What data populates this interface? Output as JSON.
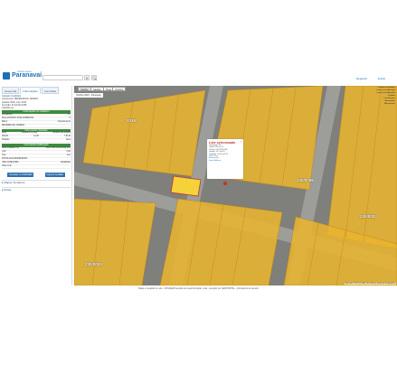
{
  "header": {
    "logo_title": "Paranavaí",
    "logo_subtitle": "PREFEITURA DE",
    "search_placeholder": "",
    "search_clear": "✕",
    "search_go": "🔍",
    "link_register": "Registrar",
    "link_login": "Entrar"
  },
  "sidebar": {
    "tabs": [
      "Geoportal",
      "Informações",
      "Consultas"
    ],
    "active_tab": 1,
    "crumb": "Cadastro Imobiliário",
    "lines": [
      "Loteamento: RESIDENCIAL VENEZA",
      "Quadra: 0036, Lote: 0013",
      "Inscrição: 01.02.023.0165",
      "Cadastro [+]",
      "[+] cadastro"
    ],
    "sections": [
      {
        "title": "Informações do Cadastro",
        "rows": [
          [
            "Logradouro",
            "KT"
          ],
          [
            "RUA ANTONIO JOSE SOBRINHO",
            "0"
          ],
          [
            "Bairro",
            "Complemento"
          ],
          [
            "RESIDENCIAL VENEZA",
            ""
          ]
        ]
      },
      {
        "title": "Informações Testadas",
        "rows": [
          [
            "Área",
            "Testada Principal",
            "Testada Secundária"
          ],
          [
            "394,00",
            "14,00",
            "7,6140"
          ],
          [
            "Frações",
            "Área"
          ]
        ]
      },
      {
        "title": "Informações Edificação",
        "rows": [
          [
            "Área Unidade (m²)",
            "Área Total Construída (m²)"
          ],
          [
            "0,00",
            "0,00"
          ],
          [
            "Tipo",
            "Ano"
          ],
          [
            "INSTALACAO/INDEFINIDO",
            ""
          ],
          [
            "USE CATEGORIA",
            "LEGENDA"
          ],
          [
            "Obter Link",
            ""
          ]
        ]
      }
    ],
    "btn_primary": "Consultar no CDSIGEM",
    "btn_secondary": "Imprimir Certidão",
    "accordions": [
      "Mapas Temáticos",
      "Rotas"
    ]
  },
  "map": {
    "tabs": [
      "Satélite",
      "Satélite",
      "Ruas",
      "Ortofoto"
    ],
    "active_tab": 0,
    "layer_title": "Ortofoto 2023 - Paranavaí",
    "legend": [
      "Cadastro imobiliário",
      "Lotes com edificação",
      "Lotes sem edificação",
      "Quadras",
      "Loteamentos",
      "Arruamento",
      "Macrozonas"
    ],
    "block_labels": [
      "0036",
      "230/0003",
      "230/0006",
      "230/0003"
    ],
    "attribution": "Map data ©2023 | Leaflet | Esri, Maxar, Earthstar Geographics",
    "popup": {
      "title": "Lote selecionado",
      "close": "×",
      "lines": [
        "Loteamento: 158",
        "Quadra: 36 Lote: 13",
        "Inscrição: 01.02.023.0165",
        "Latitude: -23.1 xxx5°S",
        "Longitude: -52.45 xxx0°W"
      ],
      "links": [
        "Street View",
        "Informações",
        "Listar Edifícios"
      ]
    }
  },
  "footer": {
    "text": "Mapa e Geração de Lote - CDSIGEM Geração de Geoinformação, Ltda - Lançado por GEOPORTAL - principais itens da web"
  },
  "colors": {
    "brand": "#1d6fb8",
    "section": "#3c8d3c",
    "lot": "#e8b430",
    "selected": "#c0392b"
  }
}
